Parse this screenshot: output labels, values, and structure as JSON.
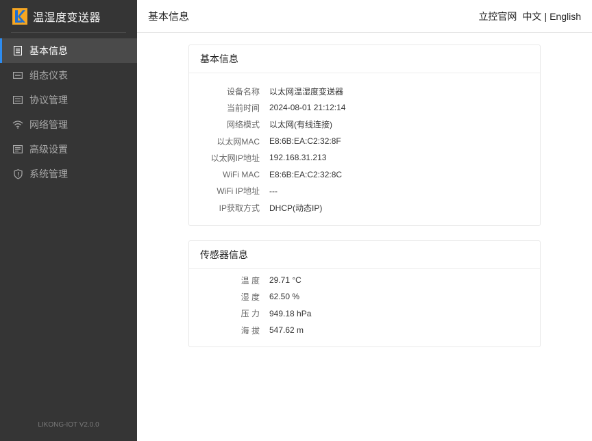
{
  "brand": {
    "title": "温湿度变送器"
  },
  "sidebar": {
    "items": [
      {
        "label": "基本信息",
        "icon": "document-icon",
        "active": true
      },
      {
        "label": "组态仪表",
        "icon": "card-icon",
        "active": false
      },
      {
        "label": "协议管理",
        "icon": "list-icon",
        "active": false
      },
      {
        "label": "网络管理",
        "icon": "wifi-icon",
        "active": false
      },
      {
        "label": "高级设置",
        "icon": "settings-list-icon",
        "active": false
      },
      {
        "label": "系统管理",
        "icon": "shield-icon",
        "active": false
      }
    ],
    "version": "LIKONG-IOT V2.0.0"
  },
  "header": {
    "title": "基本信息",
    "official_site": "立控官网",
    "lang_zh": "中文",
    "lang_sep": "|",
    "lang_en": "English"
  },
  "basic_info": {
    "title": "基本信息",
    "rows": [
      {
        "label": "设备名称",
        "value": "以太网温湿度变送器"
      },
      {
        "label": "当前时间",
        "value": "2024-08-01 21:12:14"
      },
      {
        "label": "网络模式",
        "value": "以太网(有线连接)"
      },
      {
        "label": "以太网MAC",
        "value": "E8:6B:EA:C2:32:8F"
      },
      {
        "label": "以太网IP地址",
        "value": "192.168.31.213"
      },
      {
        "label": "WiFi MAC",
        "value": "E8:6B:EA:C2:32:8C"
      },
      {
        "label": "WiFi IP地址",
        "value": "---"
      },
      {
        "label": "IP获取方式",
        "value": "DHCP(动态IP)"
      }
    ]
  },
  "sensor_info": {
    "title": "传感器信息",
    "rows": [
      {
        "label": "温 度",
        "value": "29.71 °C"
      },
      {
        "label": "湿 度",
        "value": "62.50 %"
      },
      {
        "label": "压 力",
        "value": "949.18 hPa"
      },
      {
        "label": "海 拔",
        "value": "547.62 m"
      }
    ]
  },
  "colors": {
    "sidebar_bg": "#353535",
    "active_item_bg": "#4a4a4a",
    "accent": "#2d8cf0",
    "logo_orange": "#f5a623",
    "logo_blue": "#1f6fd1"
  }
}
